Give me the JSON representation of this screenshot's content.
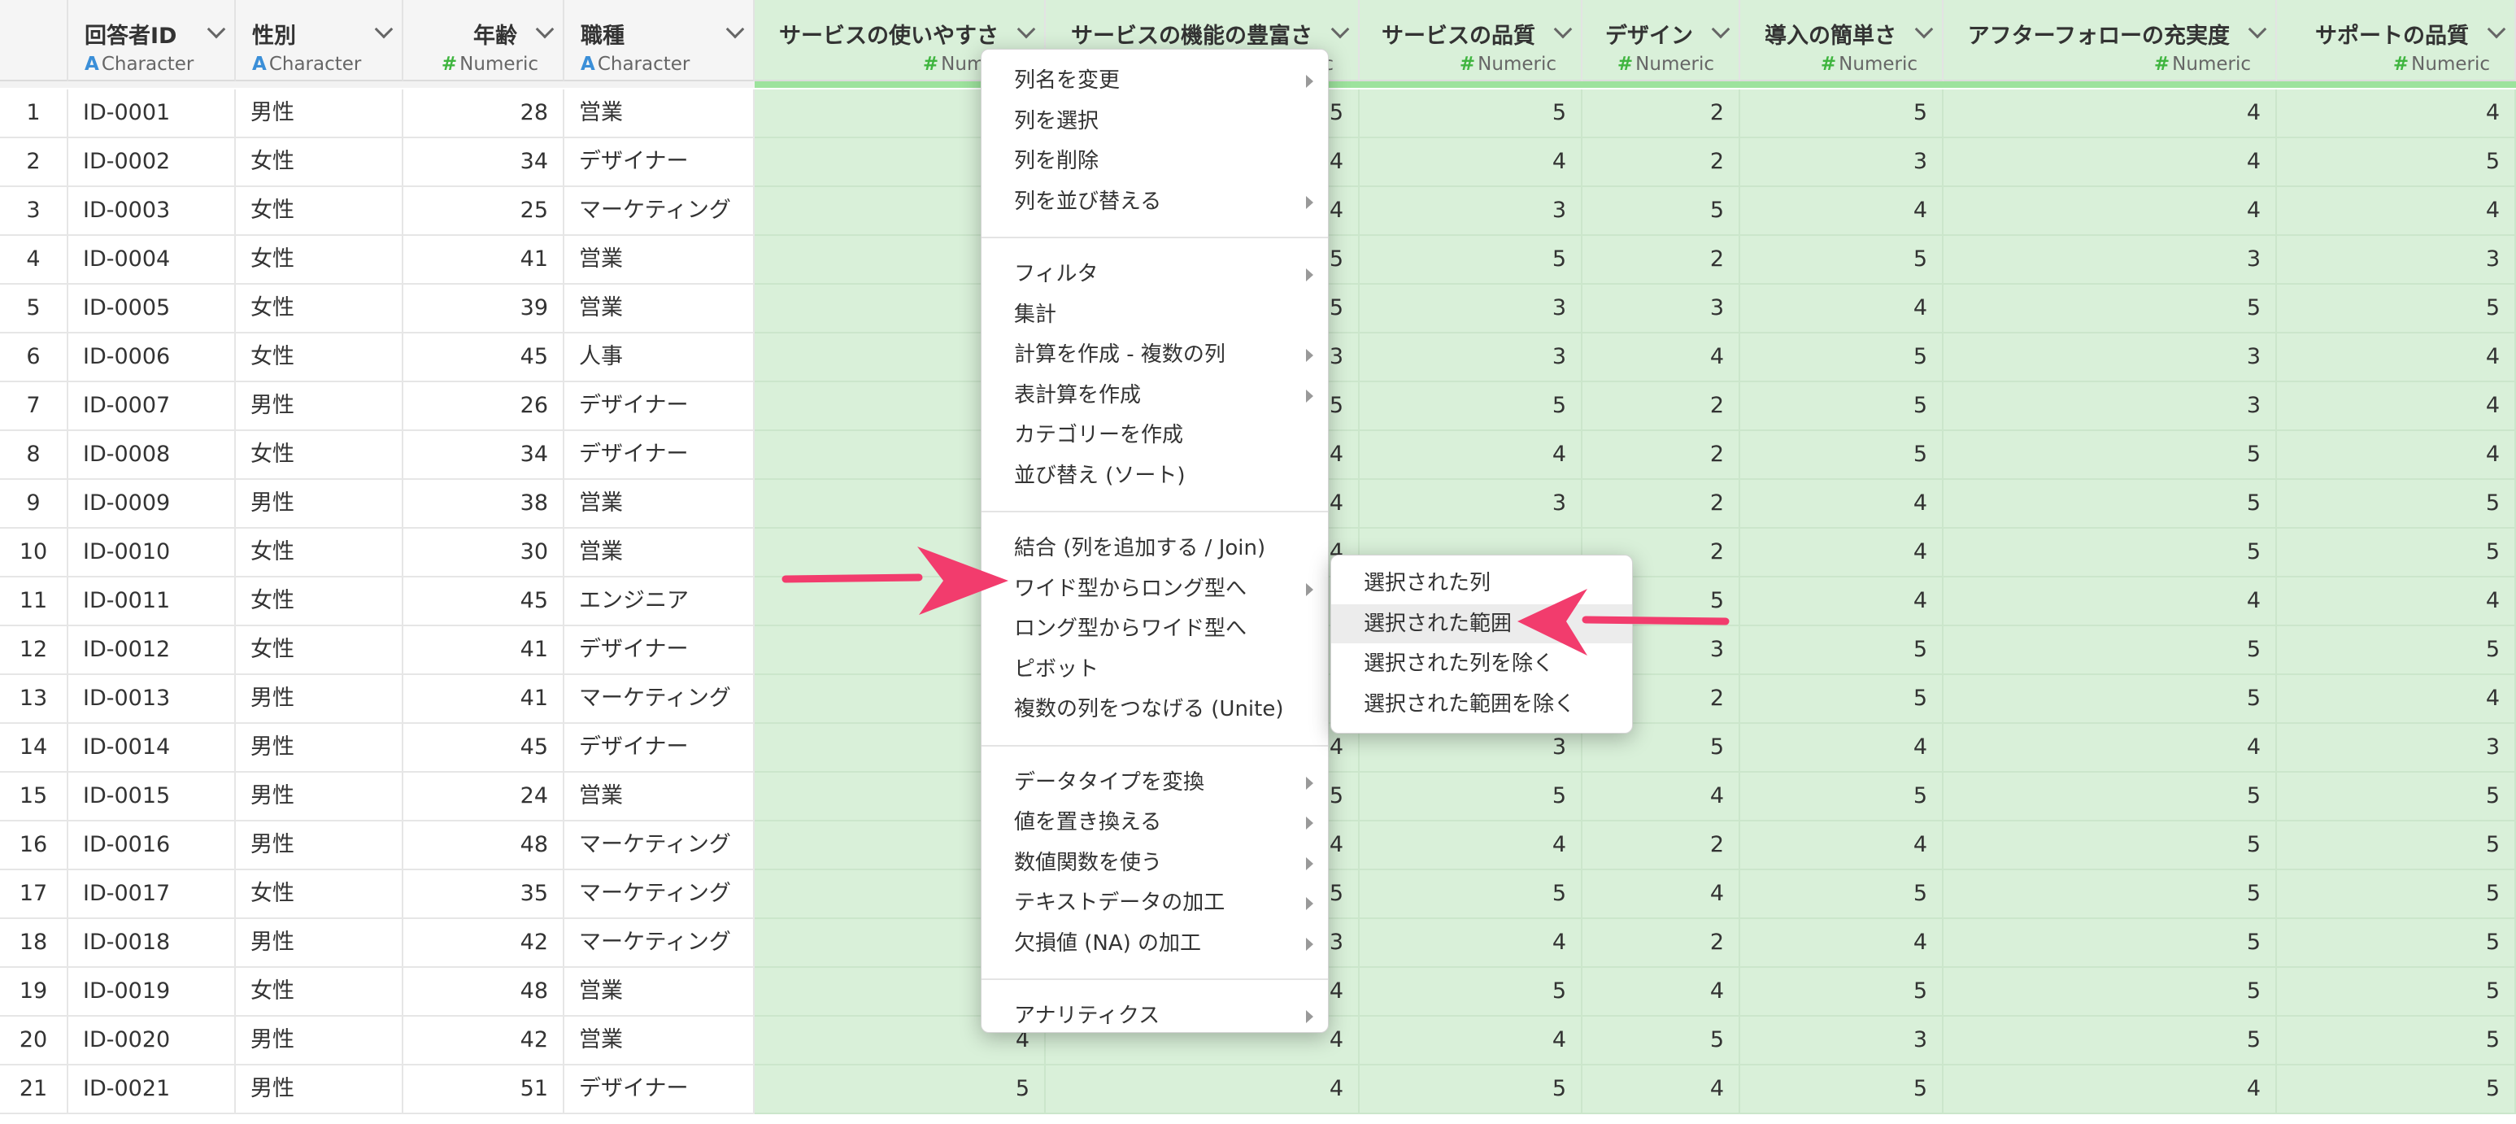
{
  "columns": [
    {
      "name": "回答者ID",
      "type": "Character",
      "align": "left",
      "selected": false
    },
    {
      "name": "性別",
      "type": "Character",
      "align": "left",
      "selected": false
    },
    {
      "name": "年齢",
      "type": "Numeric",
      "align": "right",
      "selected": false
    },
    {
      "name": "職種",
      "type": "Character",
      "align": "left",
      "selected": false
    },
    {
      "name": "サービスの使いやすさ",
      "type": "Numeric",
      "align": "right",
      "selected": true
    },
    {
      "name": "サービスの機能の豊富さ",
      "type": "Numeric",
      "align": "right",
      "selected": true
    },
    {
      "name": "サービスの品質",
      "type": "Numeric",
      "align": "right",
      "selected": true
    },
    {
      "name": "デザイン",
      "type": "Numeric",
      "align": "right",
      "selected": true
    },
    {
      "name": "導入の簡単さ",
      "type": "Numeric",
      "align": "right",
      "selected": true
    },
    {
      "name": "アフターフォローの充実度",
      "type": "Numeric",
      "align": "right",
      "selected": true
    },
    {
      "name": "サポートの品質",
      "type": "Numeric",
      "align": "right",
      "selected": true
    }
  ],
  "rows": [
    [
      "ID-0001",
      "男性",
      "28",
      "営業",
      "",
      "5",
      "5",
      "2",
      "5",
      "4",
      "4"
    ],
    [
      "ID-0002",
      "女性",
      "34",
      "デザイナー",
      "",
      "4",
      "4",
      "2",
      "3",
      "4",
      "5"
    ],
    [
      "ID-0003",
      "女性",
      "25",
      "マーケティング",
      "",
      "4",
      "3",
      "5",
      "4",
      "4",
      "4"
    ],
    [
      "ID-0004",
      "女性",
      "41",
      "営業",
      "",
      "5",
      "5",
      "2",
      "5",
      "3",
      "3"
    ],
    [
      "ID-0005",
      "女性",
      "39",
      "営業",
      "",
      "5",
      "3",
      "3",
      "4",
      "5",
      "5"
    ],
    [
      "ID-0006",
      "女性",
      "45",
      "人事",
      "",
      "3",
      "3",
      "4",
      "5",
      "3",
      "4"
    ],
    [
      "ID-0007",
      "男性",
      "26",
      "デザイナー",
      "",
      "5",
      "5",
      "2",
      "5",
      "3",
      "4"
    ],
    [
      "ID-0008",
      "女性",
      "34",
      "デザイナー",
      "",
      "4",
      "4",
      "2",
      "5",
      "5",
      "4"
    ],
    [
      "ID-0009",
      "男性",
      "38",
      "営業",
      "",
      "4",
      "3",
      "2",
      "4",
      "5",
      "5"
    ],
    [
      "ID-0010",
      "女性",
      "30",
      "営業",
      "",
      "4",
      "",
      "2",
      "4",
      "5",
      "5"
    ],
    [
      "ID-0011",
      "女性",
      "45",
      "エンジニア",
      "",
      "",
      "",
      "5",
      "4",
      "4",
      "4"
    ],
    [
      "ID-0012",
      "女性",
      "41",
      "デザイナー",
      "",
      "",
      "",
      "3",
      "5",
      "5",
      "5"
    ],
    [
      "ID-0013",
      "男性",
      "41",
      "マーケティング",
      "",
      "",
      "",
      "2",
      "5",
      "5",
      "4"
    ],
    [
      "ID-0014",
      "男性",
      "45",
      "デザイナー",
      "",
      "4",
      "3",
      "5",
      "4",
      "4",
      "3"
    ],
    [
      "ID-0015",
      "男性",
      "24",
      "営業",
      "",
      "5",
      "5",
      "4",
      "5",
      "5",
      "5"
    ],
    [
      "ID-0016",
      "男性",
      "48",
      "マーケティング",
      "",
      "4",
      "4",
      "2",
      "4",
      "5",
      "5"
    ],
    [
      "ID-0017",
      "女性",
      "35",
      "マーケティング",
      "",
      "5",
      "5",
      "4",
      "5",
      "5",
      "5"
    ],
    [
      "ID-0018",
      "男性",
      "42",
      "マーケティング",
      "",
      "3",
      "4",
      "2",
      "4",
      "5",
      "5"
    ],
    [
      "ID-0019",
      "女性",
      "48",
      "営業",
      "",
      "4",
      "5",
      "4",
      "5",
      "5",
      "5"
    ],
    [
      "ID-0020",
      "男性",
      "42",
      "営業",
      "4",
      "4",
      "4",
      "5",
      "3",
      "5",
      "5"
    ],
    [
      "ID-0021",
      "男性",
      "51",
      "デザイナー",
      "5",
      "4",
      "5",
      "4",
      "5",
      "4",
      "5"
    ]
  ],
  "context_menu": {
    "groups": [
      [
        {
          "label": "列名を変更",
          "submenu": true
        },
        {
          "label": "列を選択",
          "submenu": false
        },
        {
          "label": "列を削除",
          "submenu": false
        },
        {
          "label": "列を並び替える",
          "submenu": true
        }
      ],
      [
        {
          "label": "フィルタ",
          "submenu": true
        },
        {
          "label": "集計",
          "submenu": false
        },
        {
          "label": "計算を作成 - 複数の列",
          "submenu": true
        },
        {
          "label": "表計算を作成",
          "submenu": true
        },
        {
          "label": "カテゴリーを作成",
          "submenu": false
        },
        {
          "label": "並び替え (ソート)",
          "submenu": false
        }
      ],
      [
        {
          "label": "結合 (列を追加する / Join)",
          "submenu": false
        },
        {
          "label": "ワイド型からロング型へ",
          "submenu": true
        },
        {
          "label": "ロング型からワイド型へ",
          "submenu": false
        },
        {
          "label": "ピボット",
          "submenu": false
        },
        {
          "label": "複数の列をつなげる (Unite)",
          "submenu": false
        }
      ],
      [
        {
          "label": "データタイプを変換",
          "submenu": true
        },
        {
          "label": "値を置き換える",
          "submenu": true
        },
        {
          "label": "数値関数を使う",
          "submenu": true
        },
        {
          "label": "テキストデータの加工",
          "submenu": true
        },
        {
          "label": "欠損値 (NA) の加工",
          "submenu": true
        }
      ],
      [
        {
          "label": "アナリティクス",
          "submenu": true
        }
      ]
    ]
  },
  "submenu": {
    "items": [
      {
        "label": "選択された列",
        "highlighted": false
      },
      {
        "label": "選択された範囲",
        "highlighted": true
      },
      {
        "label": "選択された列を除く",
        "highlighted": false
      },
      {
        "label": "選択された範囲を除く",
        "highlighted": false
      }
    ]
  },
  "colors": {
    "selected_bg": "#d9f0d9",
    "selected_bar": "#9de39d",
    "arrow": "#f23c6d",
    "char_icon": "#3b8fd8",
    "num_icon": "#3fb53f"
  }
}
